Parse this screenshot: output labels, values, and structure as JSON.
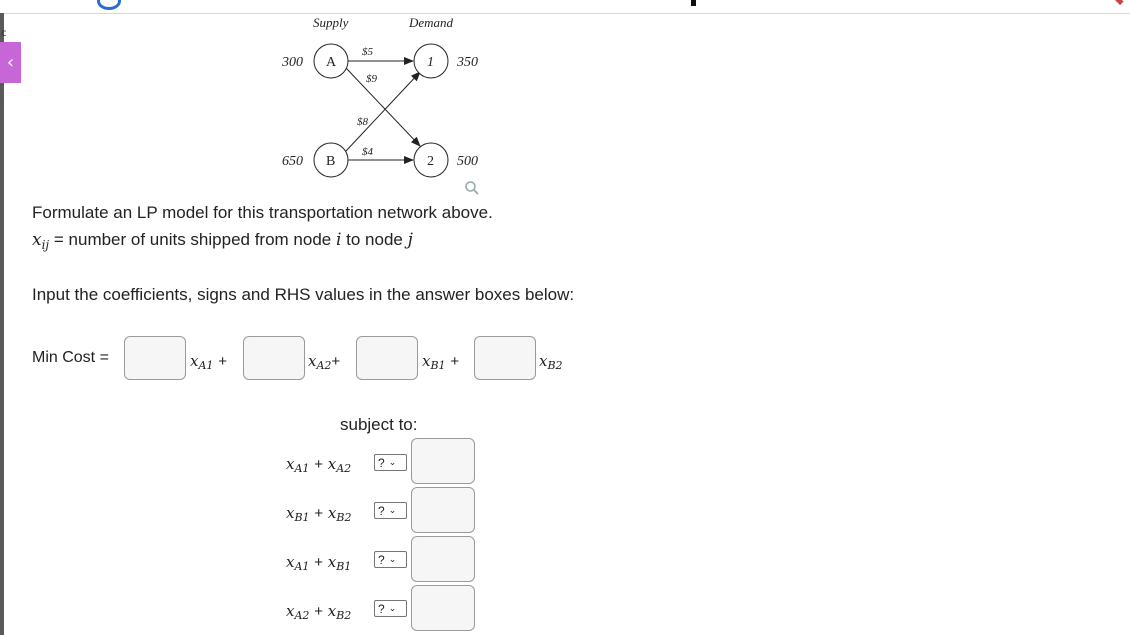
{
  "network": {
    "supply_label": "Supply",
    "demand_label": "Demand",
    "supply_nodes": [
      {
        "name": "A",
        "amount": "300"
      },
      {
        "name": "B",
        "amount": "650"
      }
    ],
    "demand_nodes": [
      {
        "name": "1",
        "amount": "350"
      },
      {
        "name": "2",
        "amount": "500"
      }
    ],
    "costs": {
      "A1": "$5",
      "A2": "$9",
      "B1": "$8",
      "B2": "$4"
    }
  },
  "problem": {
    "instruction": "Formulate an LP model for this transportation network above.",
    "var_symbol": "x",
    "var_subscript": "ij",
    "var_definition_prefix": " = number of units shipped from node ",
    "var_i": "i",
    "var_definition_mid": " to node ",
    "var_j": "j",
    "input_instruction": "Input the coefficients, signs and RHS values in the answer boxes below:"
  },
  "objective": {
    "label": "Min Cost =",
    "variables": [
      "A1",
      "A2",
      "B1",
      "B2"
    ],
    "coefficients": [
      "",
      "",
      "",
      ""
    ]
  },
  "constraints": {
    "heading": "subject to:",
    "rows": [
      {
        "lhs": [
          "A1",
          "A2"
        ],
        "sign": "?",
        "rhs": ""
      },
      {
        "lhs": [
          "B1",
          "B2"
        ],
        "sign": "?",
        "rhs": ""
      },
      {
        "lhs": [
          "A1",
          "B1"
        ],
        "sign": "?",
        "rhs": ""
      },
      {
        "lhs": [
          "A2",
          "B2"
        ],
        "sign": "?",
        "rhs": ""
      }
    ]
  },
  "symbols": {
    "x": "x",
    "plus": "+",
    "chevron": "⌄"
  },
  "icons": [
    "search-icon",
    "chevron-left-icon",
    "chevron-down-icon"
  ],
  "colors": {
    "collapse_tab": "#c766d6",
    "rail": "#5a5a5a",
    "box_bg": "#f6f6f6"
  }
}
